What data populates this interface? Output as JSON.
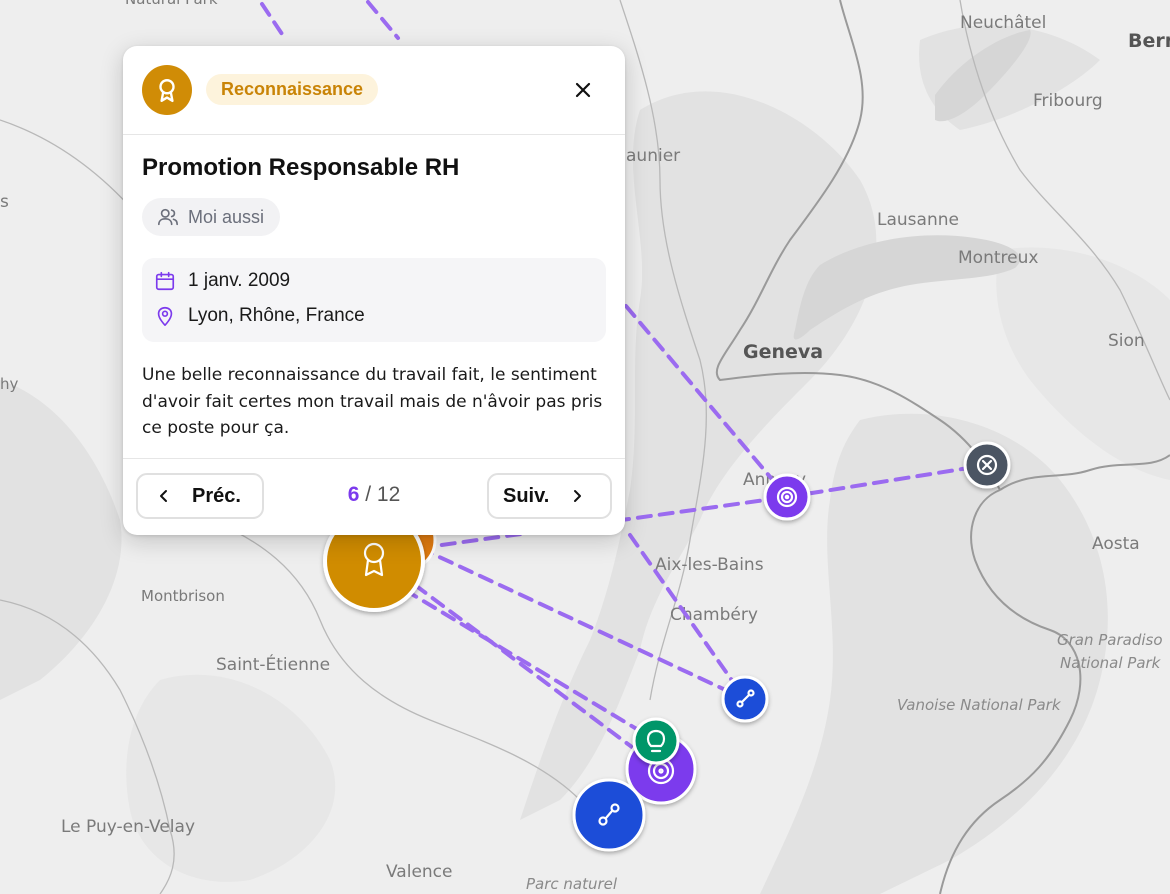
{
  "map": {
    "places": [
      {
        "id": "neuchatel",
        "label": "Neuchâtel"
      },
      {
        "id": "bern",
        "label": "Bern"
      },
      {
        "id": "fribourg",
        "label": "Fribourg"
      },
      {
        "id": "chaunier",
        "label": "aunier"
      },
      {
        "id": "lausanne",
        "label": "Lausanne"
      },
      {
        "id": "montreux",
        "label": "Montreux"
      },
      {
        "id": "sion",
        "label": "Sion"
      },
      {
        "id": "geneva",
        "label": "Geneva"
      },
      {
        "id": "annecy",
        "label": "Annecy"
      },
      {
        "id": "aosta",
        "label": "Aosta"
      },
      {
        "id": "aixlesbains",
        "label": "Aix-les-Bains"
      },
      {
        "id": "chambery",
        "label": "Chambéry"
      },
      {
        "id": "montbrison",
        "label": "Montbrison"
      },
      {
        "id": "sainte",
        "label": "Saint-Étienne"
      },
      {
        "id": "granparadiso1",
        "label": "Gran Paradiso"
      },
      {
        "id": "granparadiso2",
        "label": "National Park"
      },
      {
        "id": "vanoise",
        "label": "Vanoise National Park"
      },
      {
        "id": "lepuy",
        "label": "Le Puy-en-Velay"
      },
      {
        "id": "valence",
        "label": "Valence"
      },
      {
        "id": "parcnaturel",
        "label": "Parc naturel"
      },
      {
        "id": "edge_s",
        "label": "s"
      },
      {
        "id": "edge_hy",
        "label": "hy"
      },
      {
        "id": "naturalpark",
        "label": "Natural Park"
      }
    ],
    "markers": [
      {
        "name": "reconnaissance-marker-selected",
        "icon": "award-icon",
        "color": "#d08c06"
      },
      {
        "name": "goal-marker-annecy",
        "icon": "target-icon",
        "color": "#7c3aed"
      },
      {
        "name": "failure-marker-aosta",
        "icon": "x-circle-icon",
        "color": "#4b5563"
      },
      {
        "name": "progress-marker-chambery",
        "icon": "route-icon",
        "color": "#1d4ed8"
      },
      {
        "name": "idea-marker",
        "icon": "lightbulb-icon",
        "color": "#059669"
      },
      {
        "name": "goal-marker-grenoble",
        "icon": "target-icon",
        "color": "#7c3aed"
      },
      {
        "name": "progress-marker-grenoble",
        "icon": "route-icon",
        "color": "#1d4ed8"
      }
    ],
    "route_color": "#9b6bf0"
  },
  "card": {
    "category": "Reconnaissance",
    "category_color": "#d08c06",
    "title": "Promotion Responsable RH",
    "me_too": "Moi aussi",
    "date": "1 janv. 2009",
    "location": "Lyon, Rhône, France",
    "description": "Une belle reconnaissance du travail fait, le sentiment d'avoir fait certes mon travail mais de n'âvoir pas pris ce poste pour ça.",
    "prev_label": "Préc.",
    "next_label": "Suiv.",
    "current": "6",
    "separator": "/",
    "total": "12",
    "accent": "#7c3aed"
  }
}
